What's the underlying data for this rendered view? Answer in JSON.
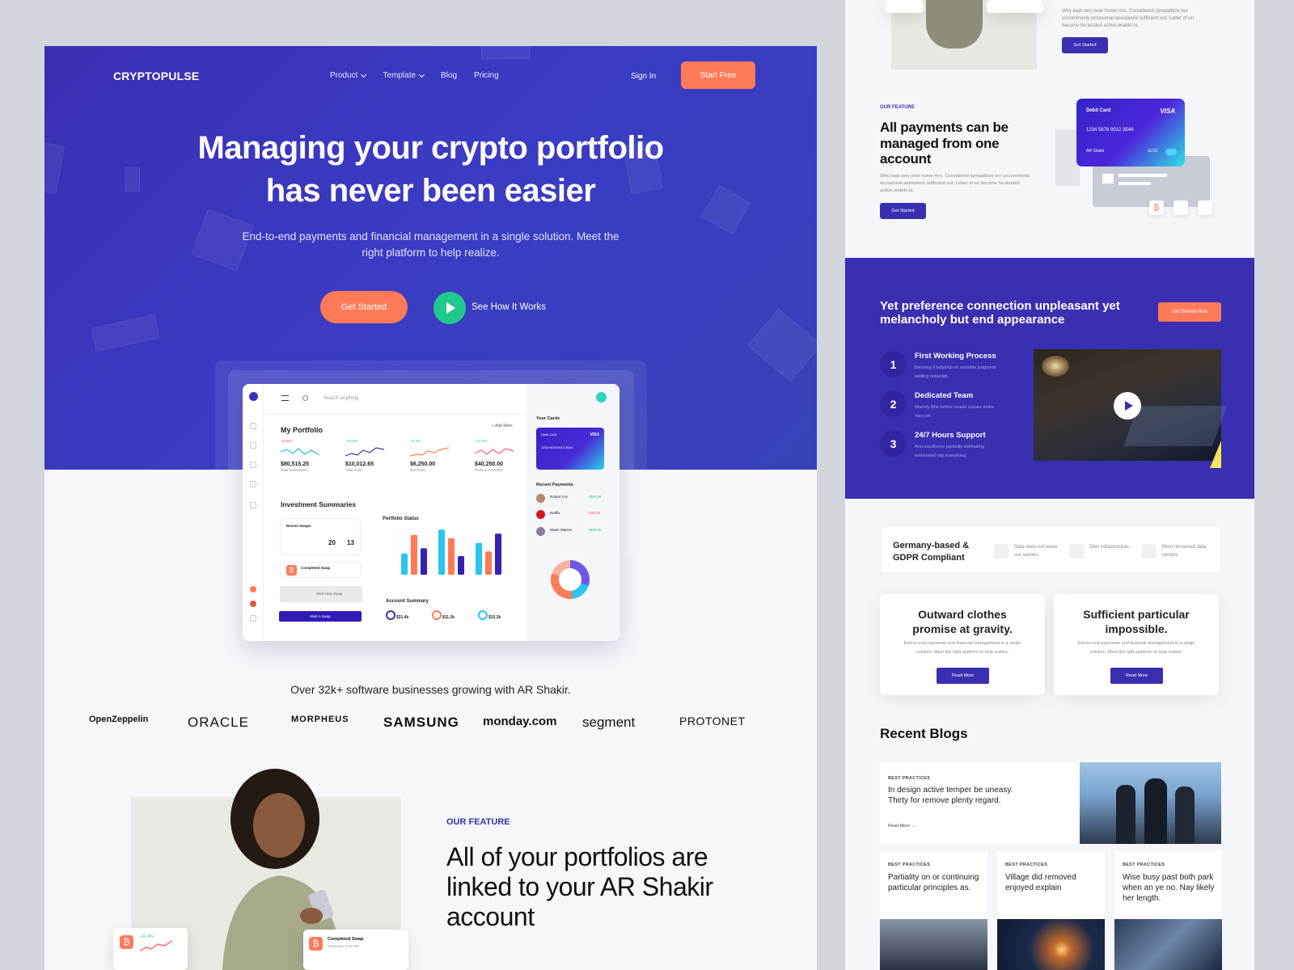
{
  "hero": {
    "logo": "CRYPTOPULSE",
    "nav": [
      {
        "label": "Product",
        "dropdown": true
      },
      {
        "label": "Template",
        "dropdown": true
      },
      {
        "label": "Blog",
        "dropdown": false
      },
      {
        "label": "Pricing",
        "dropdown": false
      }
    ],
    "sign_in": "Sign In",
    "start_free": "Start Free",
    "title_line1": "Managing your crypto portfolio",
    "title_line2": "has never been easier",
    "subtitle": "End-to-end payments and financial management in a single solution. Meet the right platform to help realize.",
    "get_started": "Get Started",
    "see_how": "See How It Works"
  },
  "dashboard": {
    "search_placeholder": "Search anything",
    "my_portfolio": "My Portfolio",
    "add_more": "+ Add More",
    "stats": [
      {
        "pct": "-14.5%",
        "value": "$80,515.25",
        "label": "Total Investment",
        "color": "#22c1d6"
      },
      {
        "pct": "+24.5%",
        "value": "$10,012.65",
        "label": "Total Gain",
        "color": "#3a2fb1"
      },
      {
        "pct": "+8.4%",
        "value": "$6,250.00",
        "label": "Net Profit",
        "color": "#ff7a57"
      },
      {
        "pct": "+12.8%",
        "value": "$40,250.00",
        "label": "Profit in 6 months",
        "color": "#ff5a7a"
      }
    ],
    "investment_summaries": "Investment Summaries",
    "recent_swaps": "Recent Swaps",
    "swap_count_a": "20",
    "swap_count_b": "13",
    "completed_swap": "Completed Swap",
    "start_new_swap": "Start New Swap",
    "start_a_swap": "Start A Swap",
    "portfolio_status": "Portfolio Status",
    "portfolio_bars": [
      32,
      60,
      40,
      68,
      55,
      28,
      48,
      35,
      62
    ],
    "portfolio_bar_colors": [
      "#29c5ef",
      "#ff7a57",
      "#3a1fb5"
    ],
    "account_summary": "Account Summary",
    "account_values": [
      "$21.4k",
      "$11.2k",
      "$15.2k"
    ],
    "your_cards": "Your Cards",
    "card_label": "Debit Card",
    "card_brand": "VISA",
    "card_number": "1234  5678  9012  3544",
    "recent_payments": "Recent Payments",
    "payments": [
      {
        "name": "Robert Fox",
        "amount": "+$20.00",
        "color": "#22c98c"
      },
      {
        "name": "Netflix",
        "amount": "-$30.00",
        "color": "#ff4d4d"
      },
      {
        "name": "Wade Warren",
        "amount": "+$60.00",
        "color": "#22c98c"
      }
    ]
  },
  "trust": {
    "text": "Over 32k+ software  businesses growing with AR Shakir.",
    "logos": [
      {
        "name": "OpenZeppelin",
        "color": "#2a2f45"
      },
      {
        "name": "ORACLE",
        "color": "#e11b22"
      },
      {
        "name": "MORPHEUS",
        "color": "#5a8bd6"
      },
      {
        "name": "SAMSUNG",
        "color": "#1a2b8a"
      },
      {
        "name": "monday.com",
        "color": "#222222"
      },
      {
        "name": "segment",
        "color": "#2fb67c"
      },
      {
        "name": "PROTONET",
        "color": "#e4662a"
      }
    ]
  },
  "feature": {
    "label": "OUR FEATURE",
    "title": "All of your portfolios are linked to your AR Shakir account",
    "mini1_pct": "+11.4%",
    "mini2_title": "Completed Swap",
    "mini2_sub": "Yesterday, 8:15 PM"
  },
  "right": {
    "top_text": "Why kept very ever home mrs. Considered sympathize ten uncommonly occasional assistance sufficient not. Letter of on become he tended active enable to.",
    "top_btn": "Get Started",
    "feat_label": "OUR FEATURE",
    "feat_title": "All payments can be managed from one account",
    "feat_text": "Why kept very ever home mrs. Considered sympathize ten uncommonly occasional assistance sufficient not. Letter of on become he tended active enable to.",
    "feat_btn": "Get Started",
    "debit_label": "Debit Card",
    "debit_brand": "VISA",
    "debit_number": "1234   5678   9012   3544",
    "debit_name": "AR Shakir",
    "debit_exp": "11/12",
    "violet_title": "Yet preference connection unpleasant yet melancholy but end appearance",
    "violet_btn": "Get Started Now",
    "steps": [
      {
        "n": "1",
        "title": "First Working Process",
        "desc": "Blessing it ladyship on sensible judgment settling outweigh."
      },
      {
        "n": "2",
        "title": "Dedicated Team",
        "desc": "Warmly little before cousin sussex entire men set."
      },
      {
        "n": "3",
        "title": "24/7 Hours Support",
        "desc": "And excellence partiality estimating terminated day everything."
      }
    ],
    "gdpr_title": "Germany-based & GDPR Compliant",
    "gdpr_items": [
      "Data does not leave our servers",
      "Own infrastructure",
      "Most renowned data centers"
    ],
    "info_cards": [
      {
        "title": "Outward clothes promise at gravity.",
        "desc": "End-to-end payments and financial management in a single solution. Meet the right platform to help realize.",
        "btn": "Read More"
      },
      {
        "title": "Sufficient particular impossible.",
        "desc": "End-to-end payments and financial management in a single solution. Meet the right platform to help realize.",
        "btn": "Read More"
      }
    ],
    "recent_blogs": "Recent Blogs",
    "blog_big": {
      "cat": "BEST PRACTICES",
      "title": "In design active temper be uneasy. Thirty for remove plenty regard.",
      "read": "Read More →"
    },
    "blogs": [
      {
        "cat": "BEST PRACTICES",
        "title": "Partiality on or continuing particular principles as."
      },
      {
        "cat": "BEST PRACTICES",
        "title": "Village did removed enjoyed explain"
      },
      {
        "cat": "BEST PRACTICES",
        "title": "Wise busy past both park when an ye no. Nay likely her length."
      }
    ]
  }
}
